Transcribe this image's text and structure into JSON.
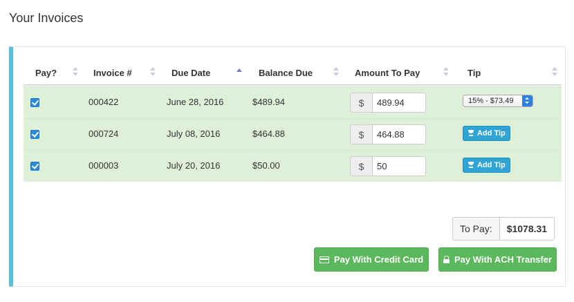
{
  "page": {
    "title": "Your Invoices"
  },
  "table": {
    "headers": [
      "Pay?",
      "Invoice #",
      "Due Date",
      "Balance Due",
      "Amount To Pay",
      "Tip"
    ],
    "rows": [
      {
        "pay": true,
        "invoice": "000422",
        "due_date": "June 28, 2016",
        "balance": "$489.94",
        "currency": "$",
        "amount": "489.94",
        "tip": "15% - $73.49"
      },
      {
        "pay": true,
        "invoice": "000724",
        "due_date": "July 08, 2016",
        "balance": "$464.88",
        "currency": "$",
        "amount": "464.88",
        "tip_button": "Add Tip"
      },
      {
        "pay": true,
        "invoice": "000003",
        "due_date": "July 20, 2016",
        "balance": "$50.00",
        "currency": "$",
        "amount": "50",
        "tip_button": "Add Tip"
      }
    ]
  },
  "summary": {
    "to_pay_label": "To Pay:",
    "to_pay_value": "$1078.31"
  },
  "actions": {
    "credit_card": "Pay With Credit Card",
    "ach": "Pay With ACH Transfer"
  },
  "colors": {
    "accent": "#5bc0de",
    "row_bg": "#dff0d8",
    "button_green": "#5cb85c",
    "button_blue": "#31a4d6"
  },
  "icons": [
    "sort-icon",
    "sort-asc-icon",
    "checkbox-icon",
    "select-arrows-icon",
    "trophy-icon",
    "credit-card-icon",
    "lock-icon"
  ]
}
